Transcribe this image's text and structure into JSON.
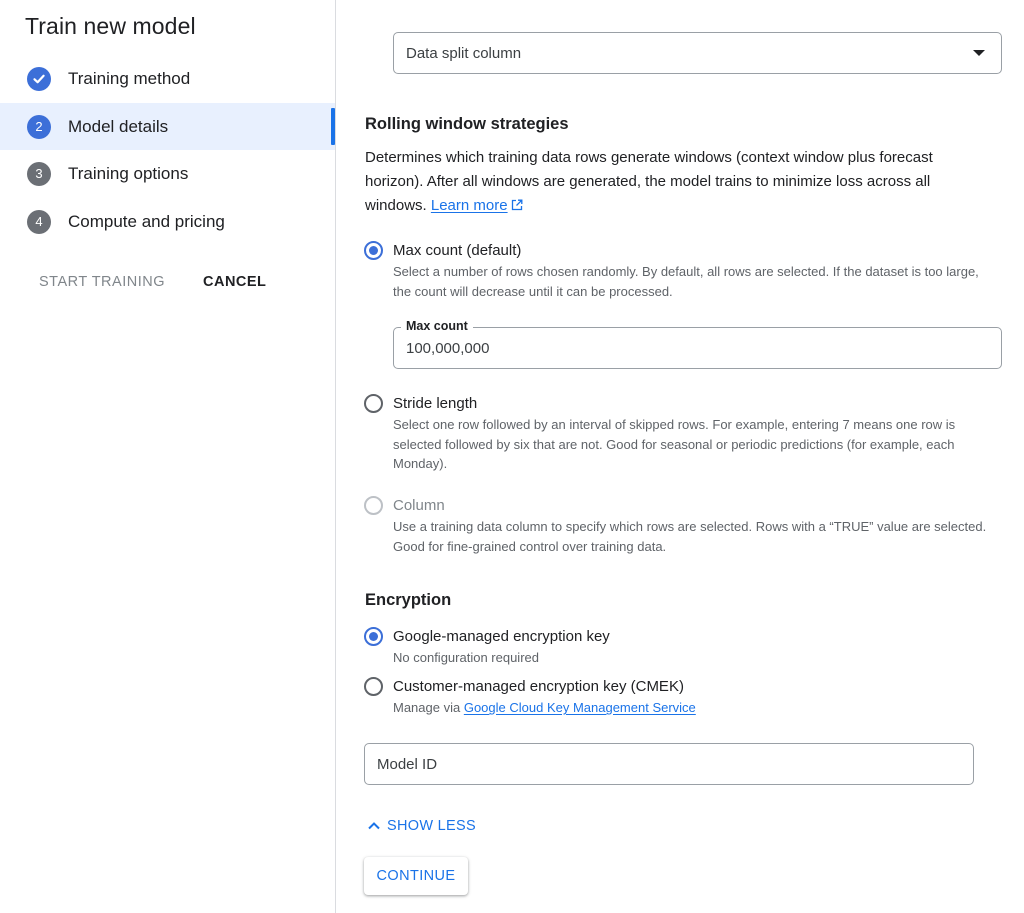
{
  "sidebar": {
    "title": "Train new model",
    "steps": [
      {
        "label": "Training method",
        "badge": "✓",
        "state": "done"
      },
      {
        "label": "Model details",
        "badge": "2",
        "state": "current"
      },
      {
        "label": "Training options",
        "badge": "3",
        "state": "todo"
      },
      {
        "label": "Compute and pricing",
        "badge": "4",
        "state": "todo"
      }
    ],
    "start_training_label": "START TRAINING",
    "cancel_label": "CANCEL"
  },
  "main": {
    "data_split_select": {
      "value": "Data split column"
    },
    "rolling_window": {
      "title": "Rolling window strategies",
      "description": "Determines which training data rows generate windows (context window plus forecast horizon). After all windows are generated, the model trains to minimize loss across all windows.",
      "learn_more": "Learn more",
      "options": [
        {
          "label": "Max count (default)",
          "help": "Select a number of rows chosen randomly. By default, all rows are selected. If the dataset is too large, the count will decrease until it can be processed.",
          "selected": true,
          "disabled": false
        },
        {
          "label": "Stride length",
          "help": "Select one row followed by an interval of skipped rows. For example, entering 7 means one row is selected followed by six that are not. Good for seasonal or periodic predictions (for example, each Monday).",
          "selected": false,
          "disabled": false
        },
        {
          "label": "Column",
          "help": "Use a training data column to specify which rows are selected. Rows with a “TRUE” value are selected. Good for fine-grained control over training data.",
          "selected": false,
          "disabled": true
        }
      ],
      "max_count_field": {
        "label": "Max count",
        "value": "100,000,000"
      }
    },
    "encryption": {
      "title": "Encryption",
      "options": [
        {
          "label": "Google-managed encryption key",
          "help": "No configuration required",
          "selected": true
        },
        {
          "label": "Customer-managed encryption key (CMEK)",
          "help_prefix": "Manage via ",
          "help_link": "Google Cloud Key Management Service",
          "selected": false
        }
      ]
    },
    "model_id_field": {
      "placeholder": "Model ID"
    },
    "show_less_label": "SHOW LESS",
    "continue_label": "CONTINUE"
  },
  "colors": {
    "accent": "#1a73e8",
    "step_badge": "#3c6fd8",
    "step_inactive": "#6b6f75",
    "active_bg": "#e8f0fe"
  }
}
